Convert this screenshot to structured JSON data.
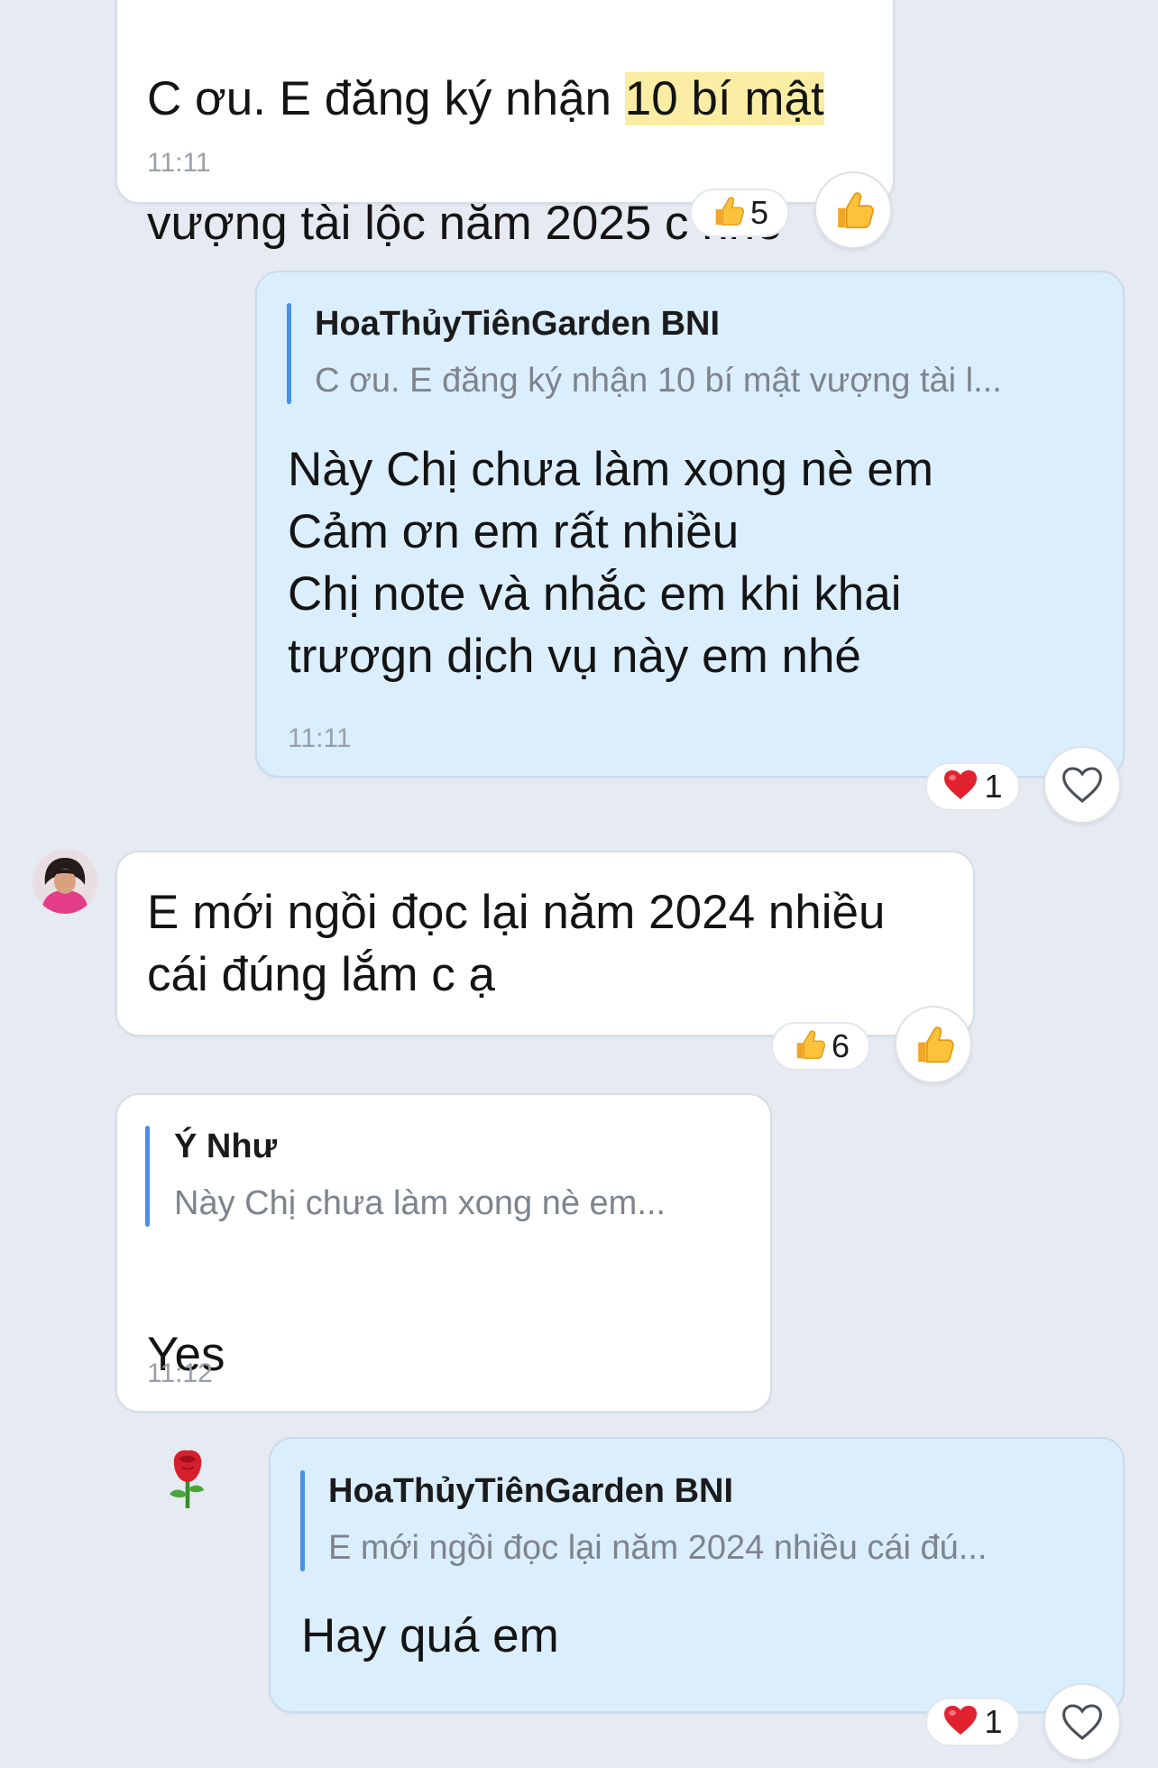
{
  "messages": [
    {
      "id": "m1",
      "line1_pre": "C ơu. E đăng ký nhận ",
      "line1_hl": "10 bí mật",
      "line2": "vượng tài lộc năm 2025 c nhé",
      "time": "11:11",
      "reaction": {
        "emoji": "thumbs-up",
        "count": "5"
      }
    },
    {
      "id": "m2",
      "quote_name": "HoaThủyTiênGarden BNI",
      "quote_text": "C ơu. E đăng ký nhận 10 bí mật vượng tài l...",
      "text": "Này Chị chưa làm xong nè em\nCảm ơn em rất nhiều\nChị note và nhắc em khi khai\ntrươgn dịch vụ này em nhé",
      "time": "11:11",
      "reaction": {
        "emoji": "heart",
        "count": "1"
      }
    },
    {
      "id": "m3",
      "text": "E mới ngồi đọc lại năm 2024 nhiều\ncái đúng lắm c ạ",
      "reaction": {
        "emoji": "thumbs-up",
        "count": "6"
      }
    },
    {
      "id": "m4",
      "quote_name": "Ý Như",
      "quote_text": "Này Chị chưa làm xong nè em...",
      "text": "Yes",
      "emoji": "rose",
      "time": "11:12"
    },
    {
      "id": "m5",
      "quote_name": "HoaThủyTiênGarden BNI",
      "quote_text": "E mới ngồi đọc lại năm 2024 nhiều cái đú...",
      "text": "Hay quá em",
      "reaction": {
        "emoji": "heart",
        "count": "1"
      }
    }
  ],
  "colors": {
    "background": "#e6eaf2",
    "incoming_bubble": "#ffffff",
    "outgoing_bubble": "#dbeefd",
    "quote_bar": "#4a8fe6",
    "highlight": "#fbeea4"
  }
}
